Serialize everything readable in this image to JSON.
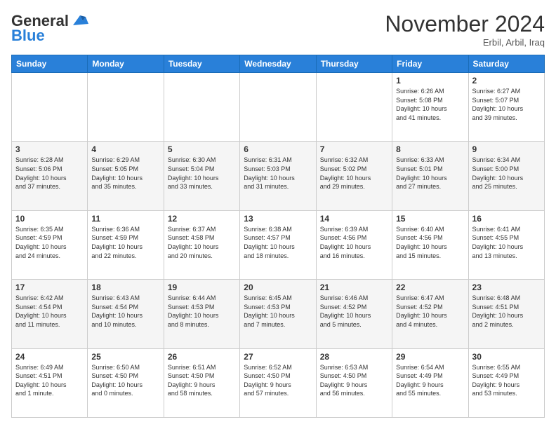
{
  "header": {
    "logo_general": "General",
    "logo_blue": "Blue",
    "month_title": "November 2024",
    "location": "Erbil, Arbil, Iraq"
  },
  "weekdays": [
    "Sunday",
    "Monday",
    "Tuesday",
    "Wednesday",
    "Thursday",
    "Friday",
    "Saturday"
  ],
  "weeks": [
    [
      {
        "day": "",
        "info": ""
      },
      {
        "day": "",
        "info": ""
      },
      {
        "day": "",
        "info": ""
      },
      {
        "day": "",
        "info": ""
      },
      {
        "day": "",
        "info": ""
      },
      {
        "day": "1",
        "info": "Sunrise: 6:26 AM\nSunset: 5:08 PM\nDaylight: 10 hours\nand 41 minutes."
      },
      {
        "day": "2",
        "info": "Sunrise: 6:27 AM\nSunset: 5:07 PM\nDaylight: 10 hours\nand 39 minutes."
      }
    ],
    [
      {
        "day": "3",
        "info": "Sunrise: 6:28 AM\nSunset: 5:06 PM\nDaylight: 10 hours\nand 37 minutes."
      },
      {
        "day": "4",
        "info": "Sunrise: 6:29 AM\nSunset: 5:05 PM\nDaylight: 10 hours\nand 35 minutes."
      },
      {
        "day": "5",
        "info": "Sunrise: 6:30 AM\nSunset: 5:04 PM\nDaylight: 10 hours\nand 33 minutes."
      },
      {
        "day": "6",
        "info": "Sunrise: 6:31 AM\nSunset: 5:03 PM\nDaylight: 10 hours\nand 31 minutes."
      },
      {
        "day": "7",
        "info": "Sunrise: 6:32 AM\nSunset: 5:02 PM\nDaylight: 10 hours\nand 29 minutes."
      },
      {
        "day": "8",
        "info": "Sunrise: 6:33 AM\nSunset: 5:01 PM\nDaylight: 10 hours\nand 27 minutes."
      },
      {
        "day": "9",
        "info": "Sunrise: 6:34 AM\nSunset: 5:00 PM\nDaylight: 10 hours\nand 25 minutes."
      }
    ],
    [
      {
        "day": "10",
        "info": "Sunrise: 6:35 AM\nSunset: 4:59 PM\nDaylight: 10 hours\nand 24 minutes."
      },
      {
        "day": "11",
        "info": "Sunrise: 6:36 AM\nSunset: 4:59 PM\nDaylight: 10 hours\nand 22 minutes."
      },
      {
        "day": "12",
        "info": "Sunrise: 6:37 AM\nSunset: 4:58 PM\nDaylight: 10 hours\nand 20 minutes."
      },
      {
        "day": "13",
        "info": "Sunrise: 6:38 AM\nSunset: 4:57 PM\nDaylight: 10 hours\nand 18 minutes."
      },
      {
        "day": "14",
        "info": "Sunrise: 6:39 AM\nSunset: 4:56 PM\nDaylight: 10 hours\nand 16 minutes."
      },
      {
        "day": "15",
        "info": "Sunrise: 6:40 AM\nSunset: 4:56 PM\nDaylight: 10 hours\nand 15 minutes."
      },
      {
        "day": "16",
        "info": "Sunrise: 6:41 AM\nSunset: 4:55 PM\nDaylight: 10 hours\nand 13 minutes."
      }
    ],
    [
      {
        "day": "17",
        "info": "Sunrise: 6:42 AM\nSunset: 4:54 PM\nDaylight: 10 hours\nand 11 minutes."
      },
      {
        "day": "18",
        "info": "Sunrise: 6:43 AM\nSunset: 4:54 PM\nDaylight: 10 hours\nand 10 minutes."
      },
      {
        "day": "19",
        "info": "Sunrise: 6:44 AM\nSunset: 4:53 PM\nDaylight: 10 hours\nand 8 minutes."
      },
      {
        "day": "20",
        "info": "Sunrise: 6:45 AM\nSunset: 4:53 PM\nDaylight: 10 hours\nand 7 minutes."
      },
      {
        "day": "21",
        "info": "Sunrise: 6:46 AM\nSunset: 4:52 PM\nDaylight: 10 hours\nand 5 minutes."
      },
      {
        "day": "22",
        "info": "Sunrise: 6:47 AM\nSunset: 4:52 PM\nDaylight: 10 hours\nand 4 minutes."
      },
      {
        "day": "23",
        "info": "Sunrise: 6:48 AM\nSunset: 4:51 PM\nDaylight: 10 hours\nand 2 minutes."
      }
    ],
    [
      {
        "day": "24",
        "info": "Sunrise: 6:49 AM\nSunset: 4:51 PM\nDaylight: 10 hours\nand 1 minute."
      },
      {
        "day": "25",
        "info": "Sunrise: 6:50 AM\nSunset: 4:50 PM\nDaylight: 10 hours\nand 0 minutes."
      },
      {
        "day": "26",
        "info": "Sunrise: 6:51 AM\nSunset: 4:50 PM\nDaylight: 9 hours\nand 58 minutes."
      },
      {
        "day": "27",
        "info": "Sunrise: 6:52 AM\nSunset: 4:50 PM\nDaylight: 9 hours\nand 57 minutes."
      },
      {
        "day": "28",
        "info": "Sunrise: 6:53 AM\nSunset: 4:50 PM\nDaylight: 9 hours\nand 56 minutes."
      },
      {
        "day": "29",
        "info": "Sunrise: 6:54 AM\nSunset: 4:49 PM\nDaylight: 9 hours\nand 55 minutes."
      },
      {
        "day": "30",
        "info": "Sunrise: 6:55 AM\nSunset: 4:49 PM\nDaylight: 9 hours\nand 53 minutes."
      }
    ]
  ]
}
